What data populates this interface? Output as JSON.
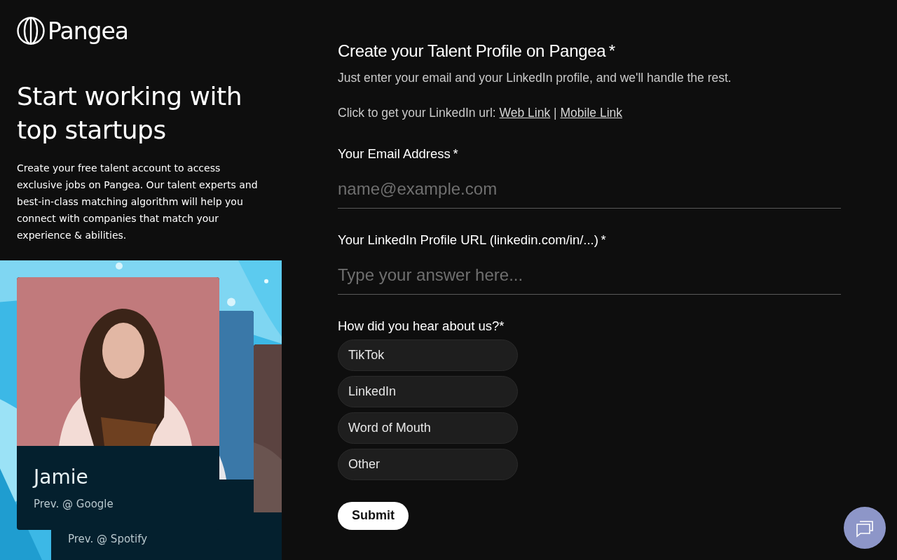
{
  "brand": {
    "name": "Pangea"
  },
  "hero": {
    "title": "Start working with top startups",
    "text": "Create your free talent account to access exclusive jobs on Pangea. Our talent experts and best-in-class matching algorithm will help you connect with companies that match your experience & abilities."
  },
  "showcase": {
    "cards": [
      {
        "name": "Jamie",
        "previous": "Prev. @ Google"
      },
      {
        "previous": "Prev. @ Spotify"
      }
    ]
  },
  "form": {
    "title": "Create your Talent Profile on Pangea",
    "title_mark": "*",
    "subtitle": "Just enter your email and your LinkedIn profile, and we'll handle the rest.",
    "link_prompt": "Click to get your LinkedIn url:",
    "links": [
      "Web Link",
      "Mobile Link"
    ],
    "link_separator": "|",
    "fields": [
      {
        "label": "Your Email Address",
        "required_mark": "*",
        "placeholder": "name@example.com"
      },
      {
        "label": "Your LinkedIn Profile URL (linkedin.com/in/...)",
        "required_mark": "*",
        "placeholder": "Type your answer here..."
      }
    ],
    "question": {
      "label": "How did you hear about us?",
      "required_mark": "*",
      "options": [
        {
          "label": "TikTok",
          "selected": false
        },
        {
          "label": "LinkedIn",
          "selected": false
        },
        {
          "label": "Word of Mouth",
          "selected": false
        },
        {
          "label": "Other",
          "selected": false
        }
      ]
    },
    "submit": "Submit"
  }
}
